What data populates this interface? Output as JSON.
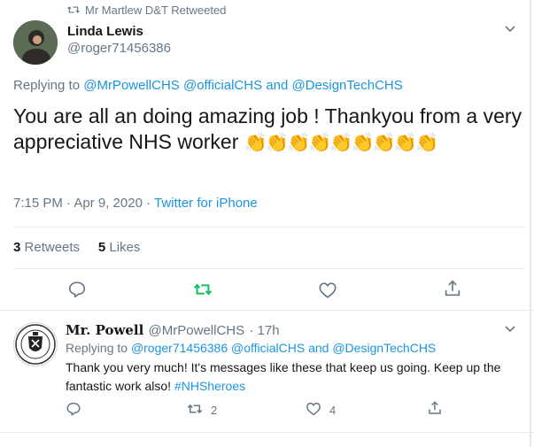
{
  "retweet_banner": {
    "text": "Mr Martlew D&T Retweeted"
  },
  "main_tweet": {
    "author_name": "Linda Lewis",
    "author_handle": "@roger71456386",
    "replying_prefix": "Replying to",
    "replying_to": "@MrPowellCHS @officialCHS and @DesignTechCHS",
    "text": "You are all an doing amazing job ! Thankyou  from a very appreciative NHS worker",
    "emoji": "👏👏👏👏👏👏👏👏👏",
    "timestamp": "7:15 PM · Apr 9, 2020 ·",
    "source": "Twitter for iPhone",
    "retweets_count": "3",
    "retweets_label": "Retweets",
    "likes_count": "5",
    "likes_label": "Likes",
    "icons": [
      "reply-icon",
      "retweet-icon",
      "like-icon",
      "share-icon",
      "chevron-down-icon"
    ],
    "colors": {
      "link": "#1b95e0",
      "retweet_active": "#17bf63",
      "muted": "#657786"
    }
  },
  "reply_tweet": {
    "author_name": "Mr. Powell",
    "author_handle": "@MrPowellCHS",
    "time": "· 17h",
    "replying_prefix": "Replying to",
    "replying_to": "@roger71456386 @officialCHS and @DesignTechCHS",
    "text_main": "Thank you very much! It's messages like these that keep us going. Keep up the fantastic work also!",
    "hashtag": "#NHSheroes",
    "retweet_count": "2",
    "like_count": "4",
    "icons": [
      "reply-icon",
      "retweet-icon",
      "like-icon",
      "share-icon",
      "chevron-down-icon"
    ]
  }
}
